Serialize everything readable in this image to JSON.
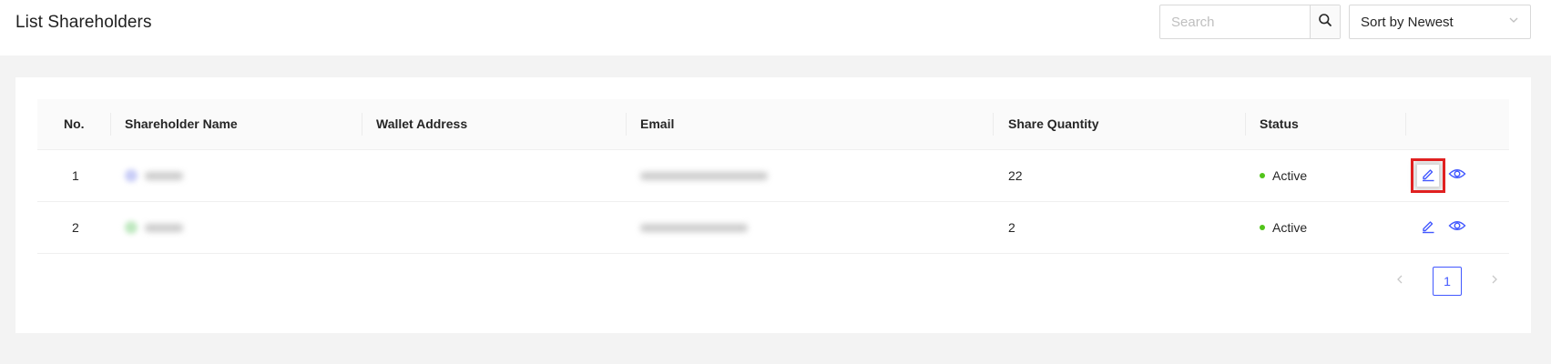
{
  "header": {
    "title": "List Shareholders",
    "search": {
      "placeholder": "Search",
      "value": ""
    },
    "sort": {
      "selected": "Sort by Newest"
    }
  },
  "table": {
    "columns": [
      "No.",
      "Shareholder Name",
      "Wallet Address",
      "Email",
      "Share Quantity",
      "Status"
    ],
    "rows": [
      {
        "no": "1",
        "share_quantity": "22",
        "status": "Active"
      },
      {
        "no": "2",
        "share_quantity": "2",
        "status": "Active"
      }
    ]
  },
  "pagination": {
    "current_page": "1"
  },
  "colors": {
    "accent": "#4258ff",
    "status_active": "#52c41a",
    "highlight": "#e02020"
  },
  "icons": {
    "search": "search-icon",
    "sort": "chevron-down-icon",
    "edit": "edit-icon",
    "view": "eye-icon",
    "prev": "chevron-left-icon",
    "next": "chevron-right-icon"
  }
}
